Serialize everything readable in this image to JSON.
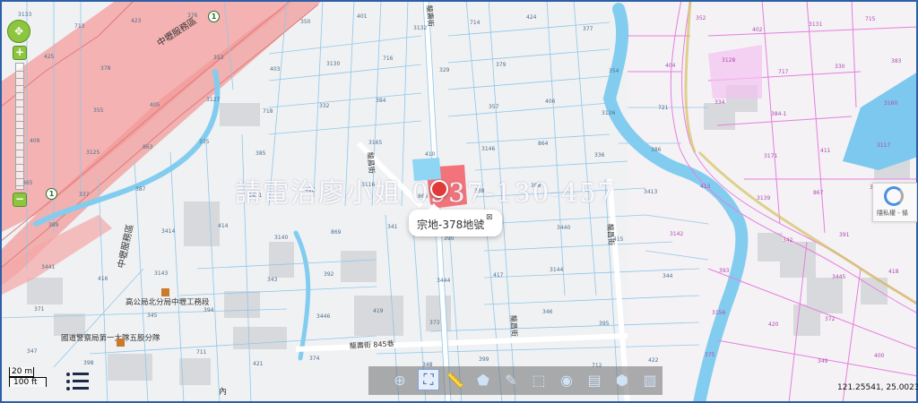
{
  "map": {
    "roads": [
      {
        "label": "中壢服務區"
      },
      {
        "label": "中壢服務區"
      },
      {
        "label": "龍壽街"
      },
      {
        "label": "龍昌街"
      },
      {
        "label": "龍壽街 845巷"
      },
      {
        "label": "龍昌街"
      },
      {
        "label": "內"
      }
    ],
    "places": [
      {
        "label": "高公局北分局中壢工務段"
      },
      {
        "label": "國道警察局第一大隊五股分隊"
      }
    ],
    "parcels": [
      "3133",
      "3132",
      "3131",
      "3130",
      "3128",
      "3127",
      "3126",
      "3125",
      "3146",
      "3117",
      "3116",
      "3139",
      "3140",
      "3142",
      "3143",
      "3144",
      "371",
      "373",
      "372",
      "374",
      "375",
      "376",
      "377",
      "378",
      "379",
      "383",
      "384",
      "384-1",
      "385",
      "386",
      "387",
      "388",
      "389",
      "390",
      "391",
      "392",
      "393",
      "394",
      "395",
      "398",
      "399",
      "400",
      "401",
      "402",
      "403",
      "404",
      "405",
      "406",
      "409",
      "410",
      "411",
      "412",
      "413",
      "414",
      "415",
      "416",
      "417",
      "418",
      "419",
      "420",
      "421",
      "422",
      "423",
      "424",
      "425",
      "329",
      "330",
      "332",
      "334",
      "335",
      "336",
      "337",
      "338",
      "340",
      "341",
      "342",
      "343",
      "344",
      "345",
      "346",
      "347",
      "348",
      "349",
      "350",
      "352",
      "353",
      "354",
      "355",
      "357",
      "3160",
      "3165",
      "3171",
      "3451",
      "3413",
      "3414",
      "3440",
      "3441",
      "3444",
      "3445",
      "3446",
      "3156",
      "711",
      "712",
      "713",
      "714",
      "715",
      "716",
      "717",
      "718",
      "721",
      "863",
      "864",
      "865",
      "866",
      "867",
      "869"
    ]
  },
  "zoom": {
    "pan_icon": "pan-arrows-icon",
    "zoom_in": "+",
    "zoom_out": "−"
  },
  "marker": {
    "icon": "location-pin-icon"
  },
  "popup": {
    "text": "宗地-378地號",
    "close": "⊠"
  },
  "watermark": {
    "text": "請電治廖小姐 0937-130-457"
  },
  "scale": {
    "metric": "20 m",
    "imperial": "100 ft"
  },
  "toolbar": {
    "tools": [
      {
        "name": "zoom-in-tool",
        "glyph": "⊕"
      },
      {
        "name": "full-extent-tool",
        "glyph": "⛶"
      },
      {
        "name": "measure-distance-tool",
        "glyph": "📏"
      },
      {
        "name": "measure-area-tool",
        "glyph": "⬟"
      },
      {
        "name": "draw-tool",
        "glyph": "✎"
      },
      {
        "name": "select-tool",
        "glyph": "⬚"
      },
      {
        "name": "locate-tool",
        "glyph": "◉"
      },
      {
        "name": "street-view-tool",
        "glyph": "▤"
      },
      {
        "name": "3d-view-tool",
        "glyph": "⬢"
      },
      {
        "name": "layers-tool",
        "glyph": "▥"
      }
    ]
  },
  "coords": {
    "text": "121.25541, 25.00237"
  },
  "captcha": {
    "text": "隱私權 - 條"
  },
  "colors": {
    "frame": "#2d5fa8",
    "highway": "#f2a0a0",
    "parcel_line": "#8fc7ea",
    "river": "#8fd1f0",
    "district_line": "#e87de0",
    "selected_parcel": "#f2737a",
    "marker": "#e03b3b"
  }
}
